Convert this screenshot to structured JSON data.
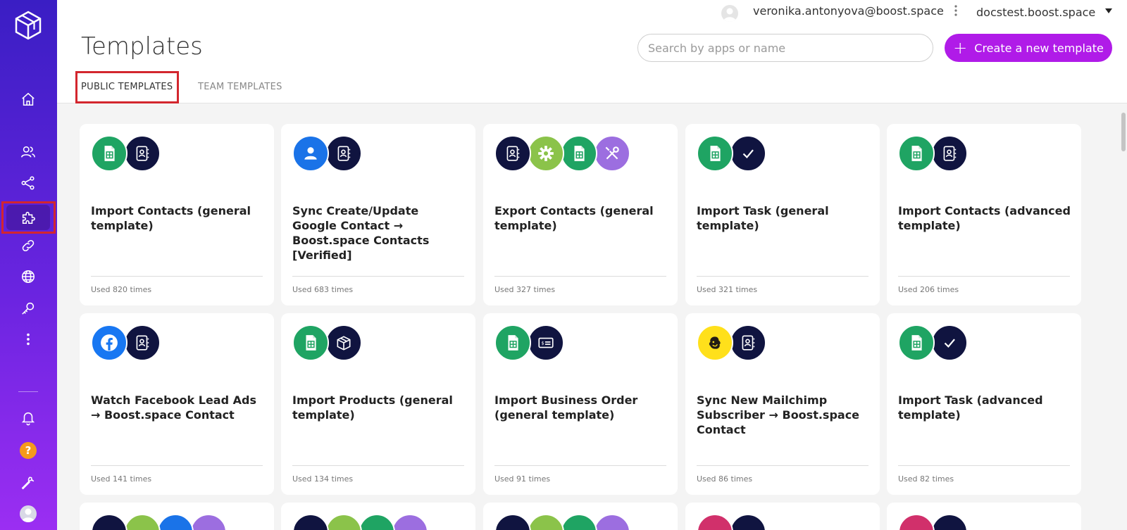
{
  "header": {
    "user_email": "veronika.antonyova@boost.space",
    "org": "docstest.boost.space",
    "page_title": "Templates",
    "search_placeholder": "Search by apps or name",
    "create_label": "Create a new template"
  },
  "tabs": [
    {
      "label": "PUBLIC TEMPLATES",
      "active": true
    },
    {
      "label": "TEAM TEMPLATES",
      "active": false
    }
  ],
  "help_label": "?",
  "colors": {
    "accent": "#b01be8",
    "highlight": "#d3262e",
    "sidebar_top": "#3a1ec4",
    "sidebar_bottom": "#9b2ef2"
  },
  "sidebar_icons": [
    "home-icon",
    "users-icon",
    "share-icon",
    "puzzle-icon",
    "link-icon",
    "globe-icon",
    "key-icon",
    "more-icon",
    "bell-icon",
    "help-icon",
    "wrench-icon",
    "avatar"
  ],
  "cards": [
    {
      "title": "Import Contacts (general template)",
      "used": "Used 820 times",
      "icons": [
        "sheets",
        "contacts-book"
      ]
    },
    {
      "title": "Sync Create/Update Google Contact → Boost.space Contacts [Verified]",
      "used": "Used 683 times",
      "icons": [
        "google-contacts",
        "contacts-book"
      ]
    },
    {
      "title": "Export Contacts (general template)",
      "used": "Used 327 times",
      "icons": [
        "contacts-book",
        "gear",
        "sheets",
        "tools"
      ]
    },
    {
      "title": "Import Task (general template)",
      "used": "Used 321 times",
      "icons": [
        "sheets",
        "check"
      ]
    },
    {
      "title": "Import Contacts (advanced template)",
      "used": "Used 206 times",
      "icons": [
        "sheets",
        "contacts-book"
      ]
    },
    {
      "title": "Watch Facebook Lead Ads → Boost.space Contact",
      "used": "Used 141 times",
      "icons": [
        "facebook",
        "contacts-book"
      ]
    },
    {
      "title": "Import Products (general template)",
      "used": "Used 134 times",
      "icons": [
        "sheets",
        "box"
      ]
    },
    {
      "title": "Import Business Order (general template)",
      "used": "Used 91 times",
      "icons": [
        "sheets",
        "invoice"
      ]
    },
    {
      "title": "Sync New Mailchimp Subscriber → Boost.space Contact",
      "used": "Used 86 times",
      "icons": [
        "mailchimp",
        "contacts-book"
      ]
    },
    {
      "title": "Import Task (advanced template)",
      "used": "Used 82 times",
      "icons": [
        "sheets",
        "check"
      ]
    }
  ]
}
